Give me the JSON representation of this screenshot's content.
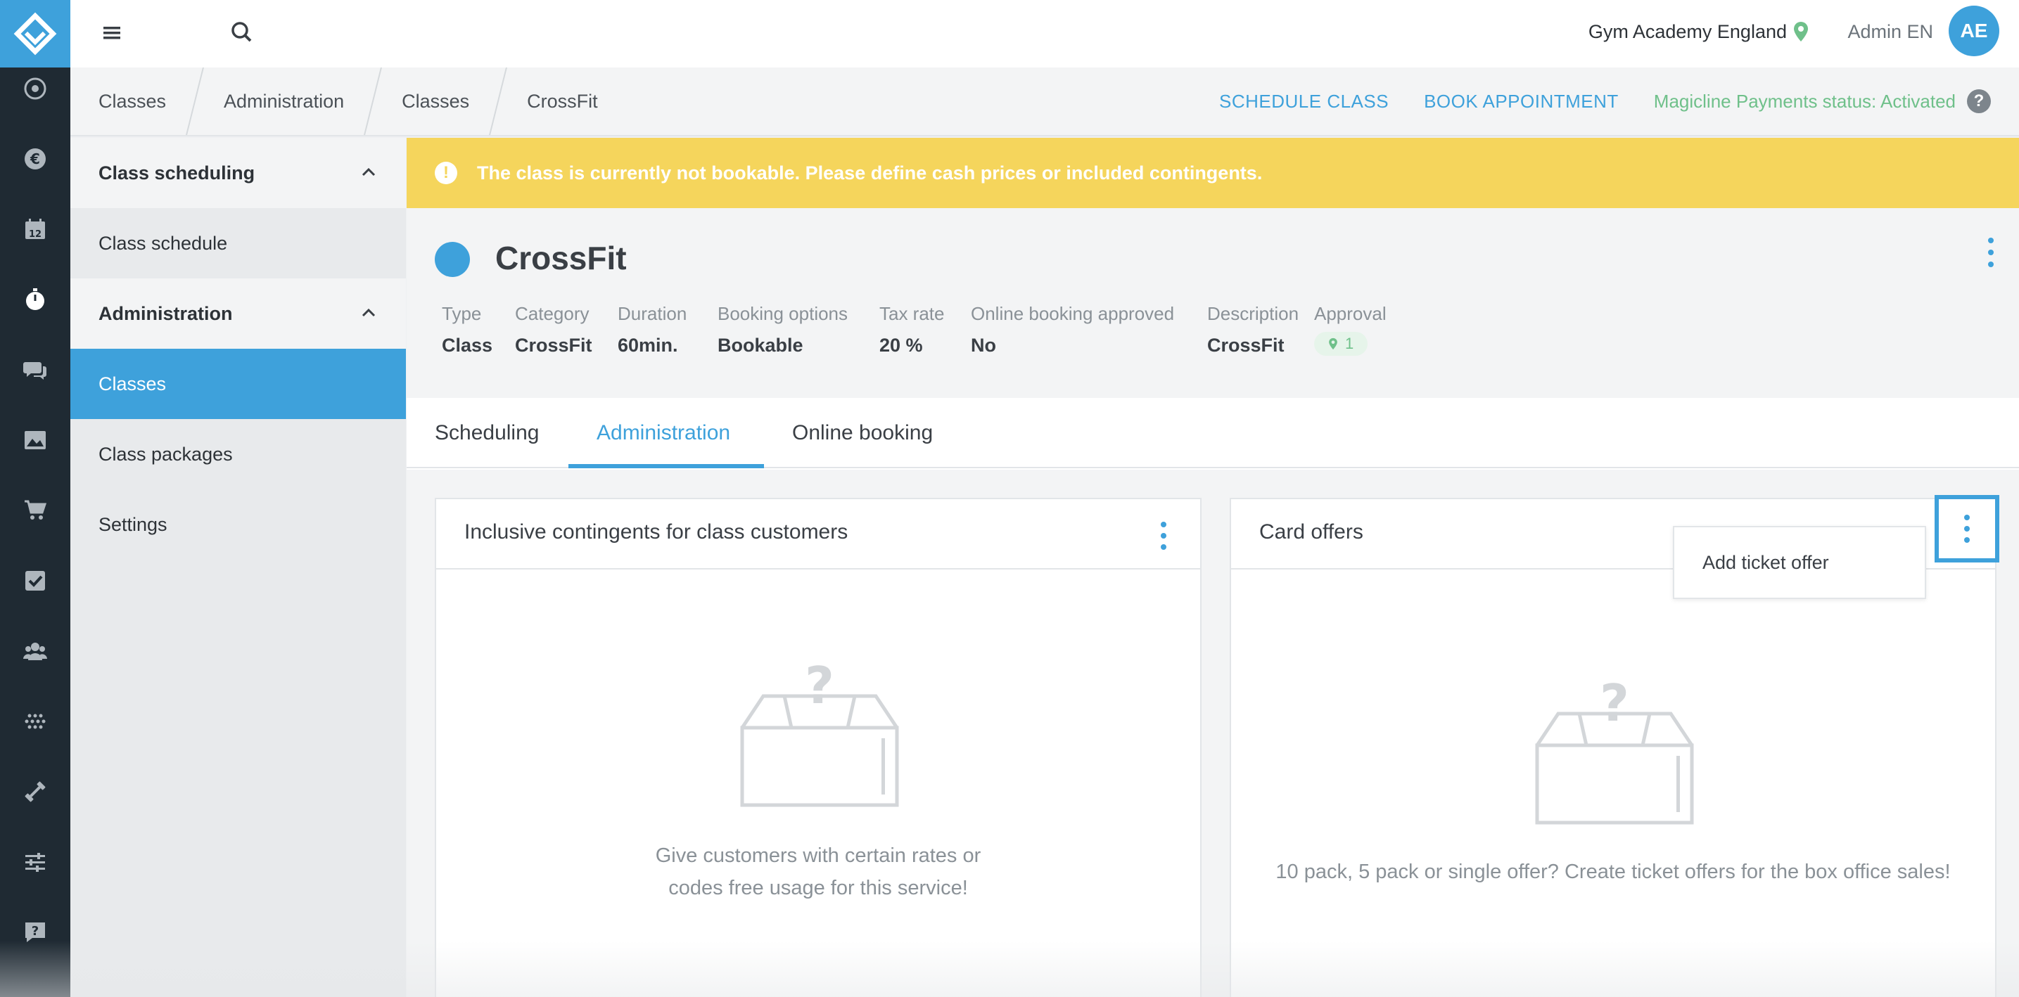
{
  "app": {
    "logo_icon": "magicline-diamond-logo-icon",
    "accent_color": "#3ea1db",
    "warning_color": "#f5d55c",
    "success_color": "#6fc08a"
  },
  "rail": {
    "icons": [
      "dashboard-icon",
      "euro-icon",
      "calendar-icon",
      "stopwatch-icon",
      "chat-icon",
      "image-icon",
      "cart-icon",
      "checkbox-icon",
      "users-icon",
      "dots-grid-icon",
      "dumbbell-icon",
      "sliders-icon",
      "feedback-icon"
    ],
    "active_icon": "stopwatch-icon",
    "calendar_number": "12"
  },
  "topbar": {
    "gym_name": "Gym Academy England",
    "admin_name": "Admin EN",
    "avatar_initials": "AE"
  },
  "breadcrumbs": [
    "Classes",
    "Administration",
    "Classes",
    "CrossFit"
  ],
  "top_actions": {
    "schedule_class": "SCHEDULE CLASS",
    "book_appointment": "BOOK APPOINTMENT",
    "payments_status": "Magicline Payments status: Activated",
    "help": "?"
  },
  "subnav": {
    "group1": {
      "label": "Class scheduling",
      "items": [
        "Class schedule"
      ]
    },
    "group2": {
      "label": "Administration",
      "items": [
        "Classes",
        "Class packages",
        "Settings"
      ],
      "active": "Classes"
    }
  },
  "warning": {
    "icon": "!",
    "text": "The class is currently not bookable. Please define cash prices or included contingents."
  },
  "class": {
    "name": "CrossFit",
    "color": "#3ea1db",
    "meta": [
      {
        "label": "Type",
        "value": "Class"
      },
      {
        "label": "Category",
        "value": "CrossFit"
      },
      {
        "label": "Duration",
        "value": "60min."
      },
      {
        "label": "Booking options",
        "value": "Bookable"
      },
      {
        "label": "Tax rate",
        "value": "20 %"
      },
      {
        "label": "Online booking approved",
        "value": "No"
      },
      {
        "label": "Description",
        "value": "CrossFit"
      },
      {
        "label": "Approval",
        "value": "1"
      }
    ]
  },
  "tabs": [
    "Scheduling",
    "Administration",
    "Online booking"
  ],
  "active_tab": "Administration",
  "panels": {
    "contingents": {
      "title": "Inclusive contingents for class customers",
      "empty_line1": "Give customers with certain rates or",
      "empty_line2": "codes free usage for this service!"
    },
    "card_offers": {
      "title": "Card offers",
      "empty_text": "10 pack, 5 pack or single offer? Create ticket offers for the box office sales!",
      "menu_item": "Add ticket offer"
    }
  }
}
